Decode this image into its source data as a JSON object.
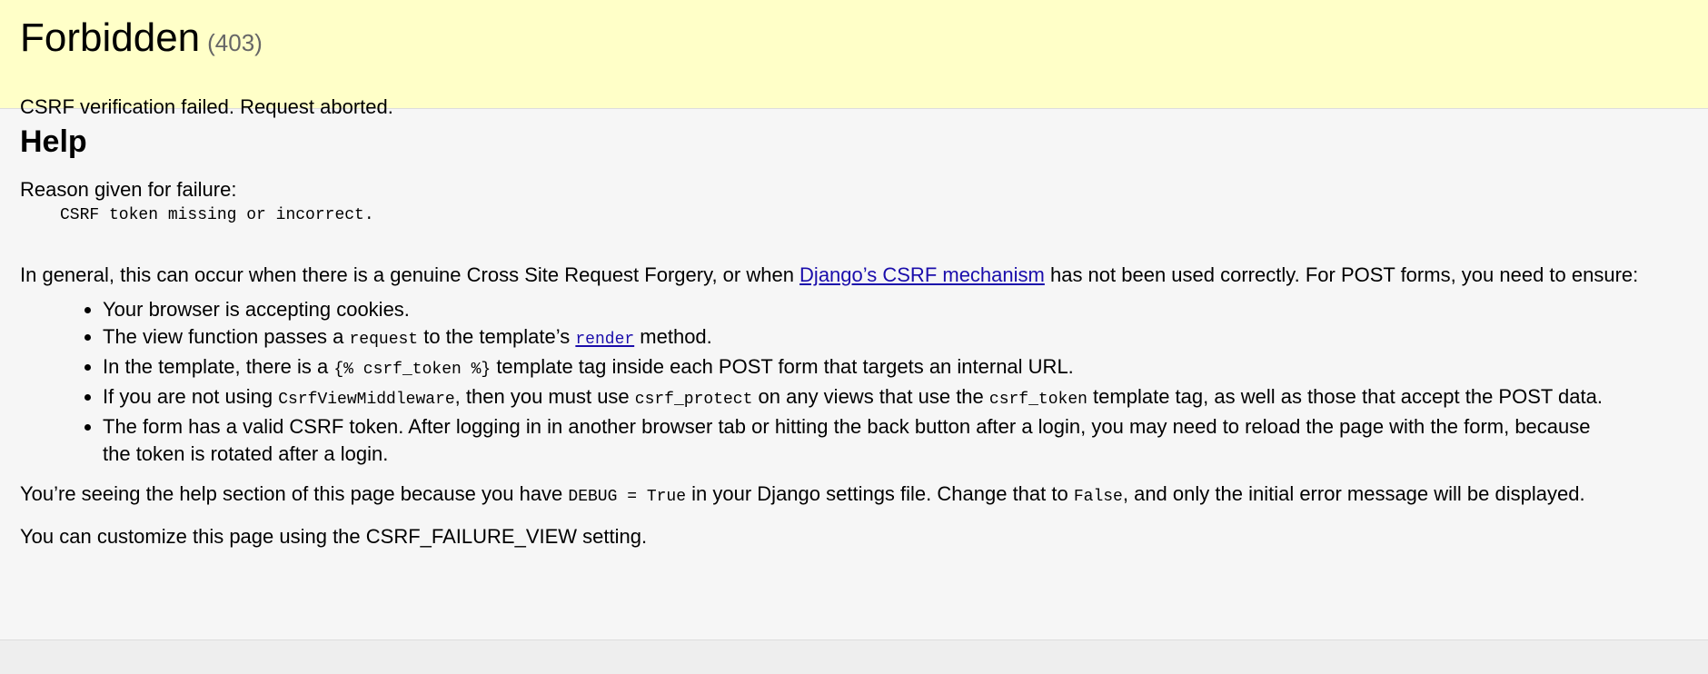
{
  "summary": {
    "title": "Forbidden",
    "status": "(403)",
    "message": "CSRF verification failed. Request aborted."
  },
  "help": {
    "heading": "Help",
    "reason_label": "Reason given for failure:",
    "reason": "CSRF token missing or incorrect.",
    "intro_before": "In general, this can occur when there is a genuine Cross Site Request Forgery, or when ",
    "intro_link": "Django’s CSRF mechanism",
    "intro_after": " has not been used correctly. For POST forms, you need to ensure:",
    "items": {
      "i0": "Your browser is accepting cookies.",
      "i1_a": "The view function passes a ",
      "i1_code": "request",
      "i1_b": " to the template’s ",
      "i1_link": "render",
      "i1_c": " method.",
      "i2_a": "In the template, there is a ",
      "i2_code": "{% csrf_token %}",
      "i2_b": " template tag inside each POST form that targets an internal URL.",
      "i3_a": "If you are not using ",
      "i3_code1": "CsrfViewMiddleware",
      "i3_b": ", then you must use ",
      "i3_code2": "csrf_protect",
      "i3_c": " on any views that use the ",
      "i3_code3": "csrf_token",
      "i3_d": " template tag, as well as those that accept the POST data.",
      "i4": "The form has a valid CSRF token. After logging in in another browser tab or hitting the back button after a login, you may need to reload the page with the form, because the token is rotated after a login."
    },
    "debug_a": "You’re seeing the help section of this page because you have ",
    "debug_code1": "DEBUG = True",
    "debug_b": " in your Django settings file. Change that to ",
    "debug_code2": "False",
    "debug_c": ", and only the initial error message will be displayed.",
    "customize": "You can customize this page using the CSRF_FAILURE_VIEW setting."
  },
  "colors": {
    "summary_bg": "#ffffc8",
    "info_bg": "#f6f6f6",
    "link": "#1a0dab"
  }
}
